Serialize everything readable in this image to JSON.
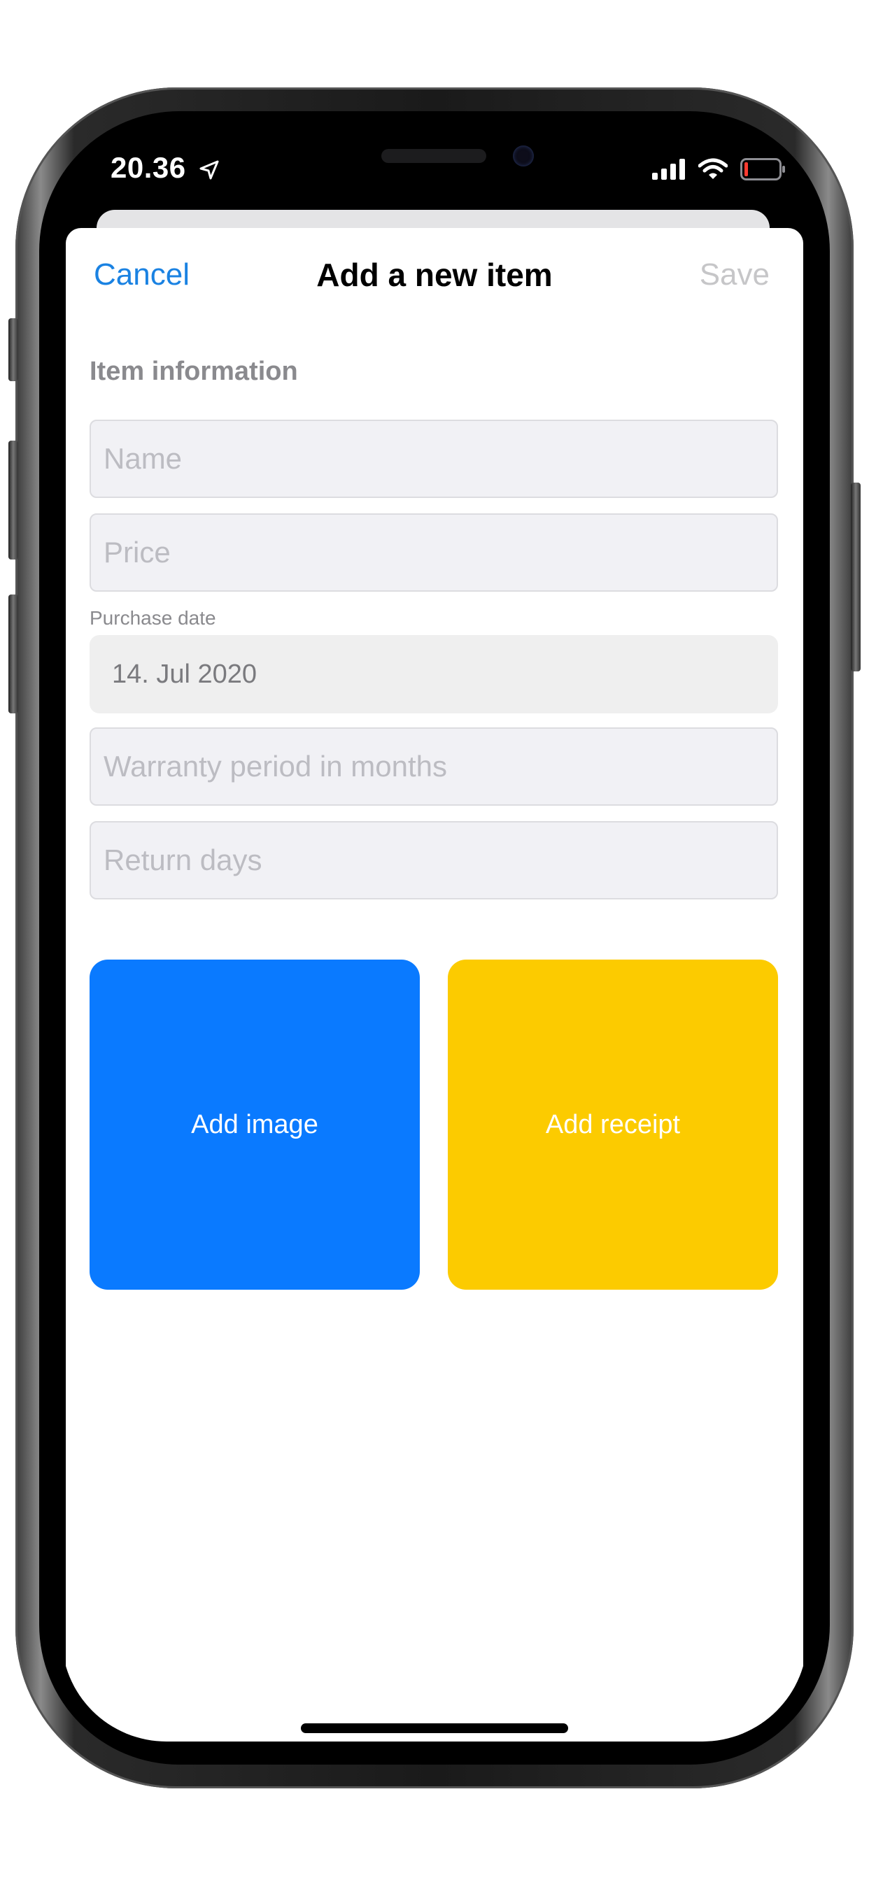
{
  "status_bar": {
    "time": "20.36"
  },
  "nav": {
    "cancel_label": "Cancel",
    "title": "Add a new item",
    "save_label": "Save"
  },
  "form": {
    "section_title": "Item information",
    "name_placeholder": "Name",
    "price_placeholder": "Price",
    "purchase_date_label": "Purchase date",
    "purchase_date_value": "14. Jul 2020",
    "warranty_placeholder": "Warranty period in months",
    "return_days_placeholder": "Return days"
  },
  "actions": {
    "add_image_label": "Add image",
    "add_image_color": "#0a7aff",
    "add_receipt_label": "Add receipt",
    "add_receipt_color": "#fccb00"
  },
  "colors": {
    "accent": "#1a82e2",
    "disabled": "#c6c6c8"
  }
}
